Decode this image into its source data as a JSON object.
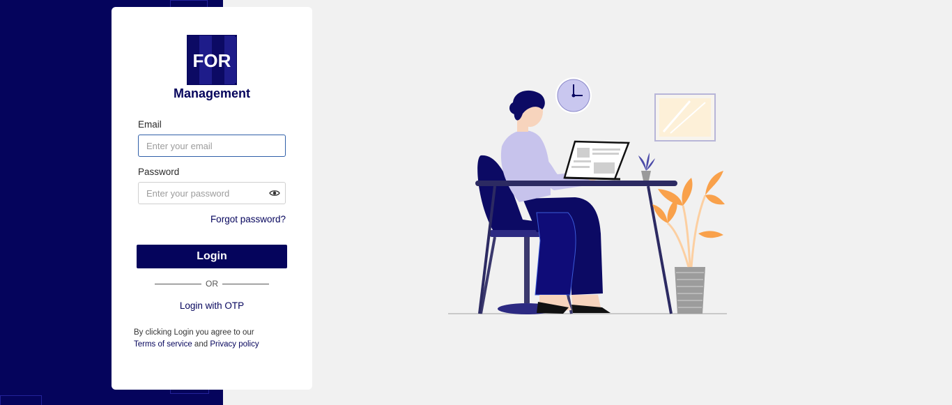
{
  "brand": {
    "logo_text": "FOR",
    "name": "Management"
  },
  "form": {
    "email_label": "Email",
    "email_placeholder": "Enter your email",
    "email_value": "",
    "password_label": "Password",
    "password_placeholder": "Enter your password",
    "password_value": "",
    "forgot_password": "Forgot password?",
    "login_button": "Login",
    "or_text": "OR",
    "otp_link": "Login with OTP"
  },
  "terms": {
    "prefix": "By clicking Login you agree to our",
    "terms_link": "Terms of service",
    "and_text": "and",
    "privacy_link": "Privacy policy"
  },
  "icons": {
    "password_toggle": "eye-icon"
  },
  "colors": {
    "brand_navy": "#05045c",
    "background": "#f1f1f1",
    "card": "#ffffff",
    "plant_orange": "#f9a14b",
    "chair_navy": "#0c0a64"
  }
}
